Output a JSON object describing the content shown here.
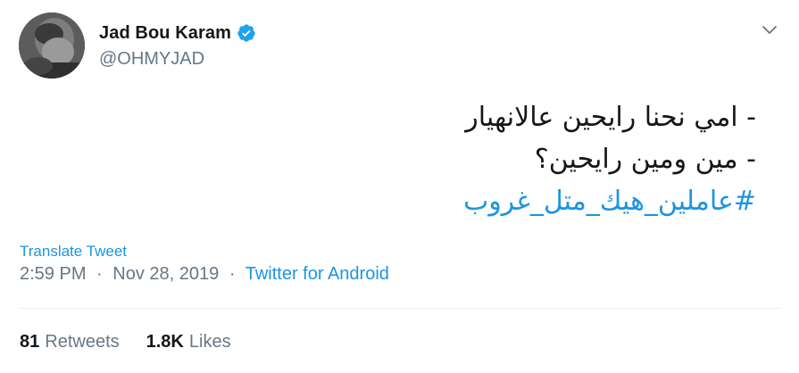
{
  "user": {
    "display_name": "Jad Bou Karam",
    "handle": "@OHMYJAD",
    "verified": true,
    "avatar_icon": "user-avatar-photo"
  },
  "tweet": {
    "lines": [
      "- امي نحنا رايحين عالانهيار",
      "- مين ومين رايحين؟"
    ],
    "hashtag": "#عاملين_هيك_متل_غروب"
  },
  "translate_label": "Translate Tweet",
  "meta": {
    "time": "2:59 PM",
    "date": "Nov 28, 2019",
    "separator": "·",
    "source": "Twitter for Android"
  },
  "stats": {
    "retweets_count": "81",
    "retweets_label": "Retweets",
    "likes_count": "1.8K",
    "likes_label": "Likes"
  },
  "colors": {
    "accent": "#1b95e0",
    "verified": "#1da1f2",
    "muted": "#657786",
    "text": "#14171a",
    "divider": "#e6ecf0"
  },
  "icons": {
    "verified": "verified-badge-icon",
    "caret": "chevron-down-icon"
  }
}
